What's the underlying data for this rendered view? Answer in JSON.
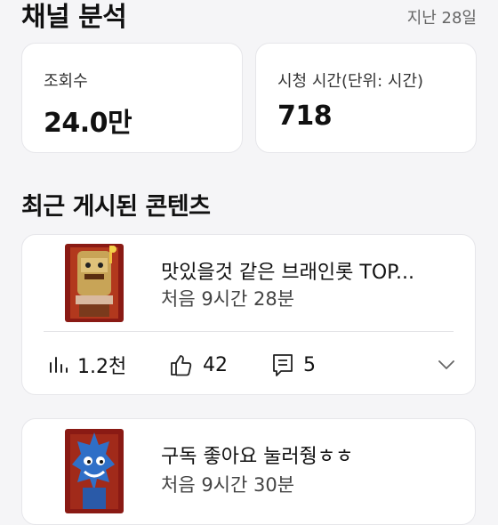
{
  "header": {
    "title": "채널 분석",
    "period": "지난 28일"
  },
  "stats": {
    "views": {
      "label": "조회수",
      "value": "24.0만"
    },
    "watch_time": {
      "label": "시청 시간(단위: 시간)",
      "value": "718"
    }
  },
  "recent": {
    "title": "최근 게시된 콘텐츠",
    "items": [
      {
        "title": "맛있을것 같은 브래인롯 TOP...",
        "time": "처음 9시간 28분",
        "views": "1.2천",
        "likes": "42",
        "comments": "5",
        "thumbnail_icon": "brainrot-bread-thumbnail"
      },
      {
        "title": "구독 좋아요 눌러줭ㅎㅎ",
        "time": "처음 9시간 30분",
        "thumbnail_icon": "blue-monster-thumbnail"
      }
    ]
  },
  "icons": {
    "views": "bar-chart-icon",
    "likes": "thumbs-up-icon",
    "comments": "comment-icon",
    "expand": "chevron-down-icon"
  },
  "colors": {
    "background": "#f5f5f7",
    "card": "#ffffff",
    "text": "#111111",
    "muted": "#666666"
  }
}
